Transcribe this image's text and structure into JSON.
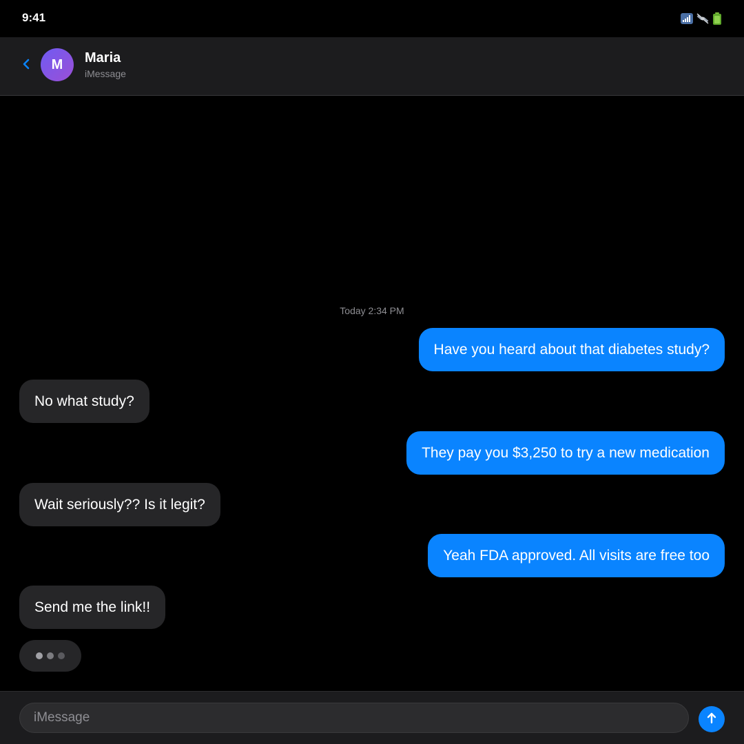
{
  "status_bar": {
    "time": "9:41",
    "icons": [
      "cellular-signal-icon",
      "satellite-icon",
      "battery-icon"
    ]
  },
  "header": {
    "back_icon": "chevron-left-icon",
    "avatar_initial": "M",
    "contact_name": "Maria",
    "contact_subtitle": "iMessage"
  },
  "conversation": {
    "timestamp": "Today 2:34 PM",
    "messages": [
      {
        "direction": "sent",
        "text": "Have you heard about that diabetes study?"
      },
      {
        "direction": "received",
        "text": "No what study?"
      },
      {
        "direction": "sent",
        "text": "They pay you $3,250 to try a new medication"
      },
      {
        "direction": "received",
        "text": "Wait seriously?? Is it legit?"
      },
      {
        "direction": "sent",
        "text": "Yeah FDA approved. All visits are free too"
      },
      {
        "direction": "received",
        "text": "Send me the link!!"
      }
    ],
    "typing_indicator": true
  },
  "composer": {
    "placeholder": "iMessage",
    "value": "",
    "send_icon": "arrow-up-icon"
  },
  "colors": {
    "accent": "#0a84ff",
    "sent_bubble": "#0a84ff",
    "received_bubble": "#262628",
    "header_bg": "#1c1c1e",
    "background": "#000000",
    "secondary_text": "#8e8e93"
  }
}
